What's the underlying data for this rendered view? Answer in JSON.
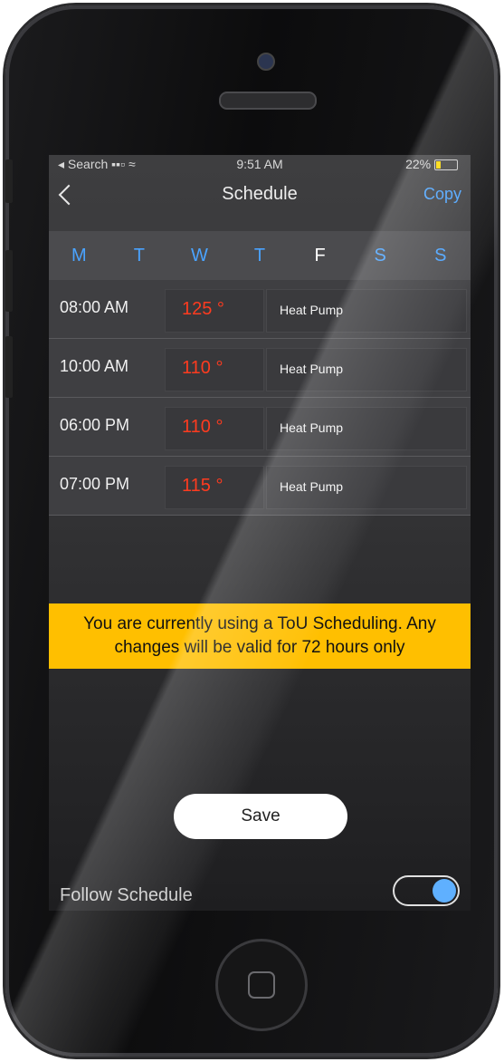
{
  "status_bar": {
    "carrier": "◂ Search ▪▪▫ ≈",
    "time": "9:51 AM",
    "battery": "22%"
  },
  "header": {
    "title": "Schedule",
    "copy_label": "Copy"
  },
  "days": [
    "M",
    "T",
    "W",
    "T",
    "F",
    "S",
    "S"
  ],
  "selected_day_index": 4,
  "schedule": [
    {
      "time": "08:00 AM",
      "temp": "125 °",
      "mode": "Heat Pump"
    },
    {
      "time": "10:00 AM",
      "temp": "110 °",
      "mode": "Heat Pump"
    },
    {
      "time": "06:00 PM",
      "temp": "110 °",
      "mode": "Heat Pump"
    },
    {
      "time": "07:00 PM",
      "temp": "115 °",
      "mode": "Heat Pump"
    }
  ],
  "banner": {
    "line1": "You are currently using a ToU Scheduling.  Any",
    "line2": "changes will be valid for 72 hours only"
  },
  "save_label": "Save",
  "follow_schedule": {
    "label": "Follow Schedule",
    "enabled": true
  },
  "colors": {
    "accent": "#4aa3ff",
    "temperature": "#ff3b1f",
    "banner": "#ffbf00"
  }
}
